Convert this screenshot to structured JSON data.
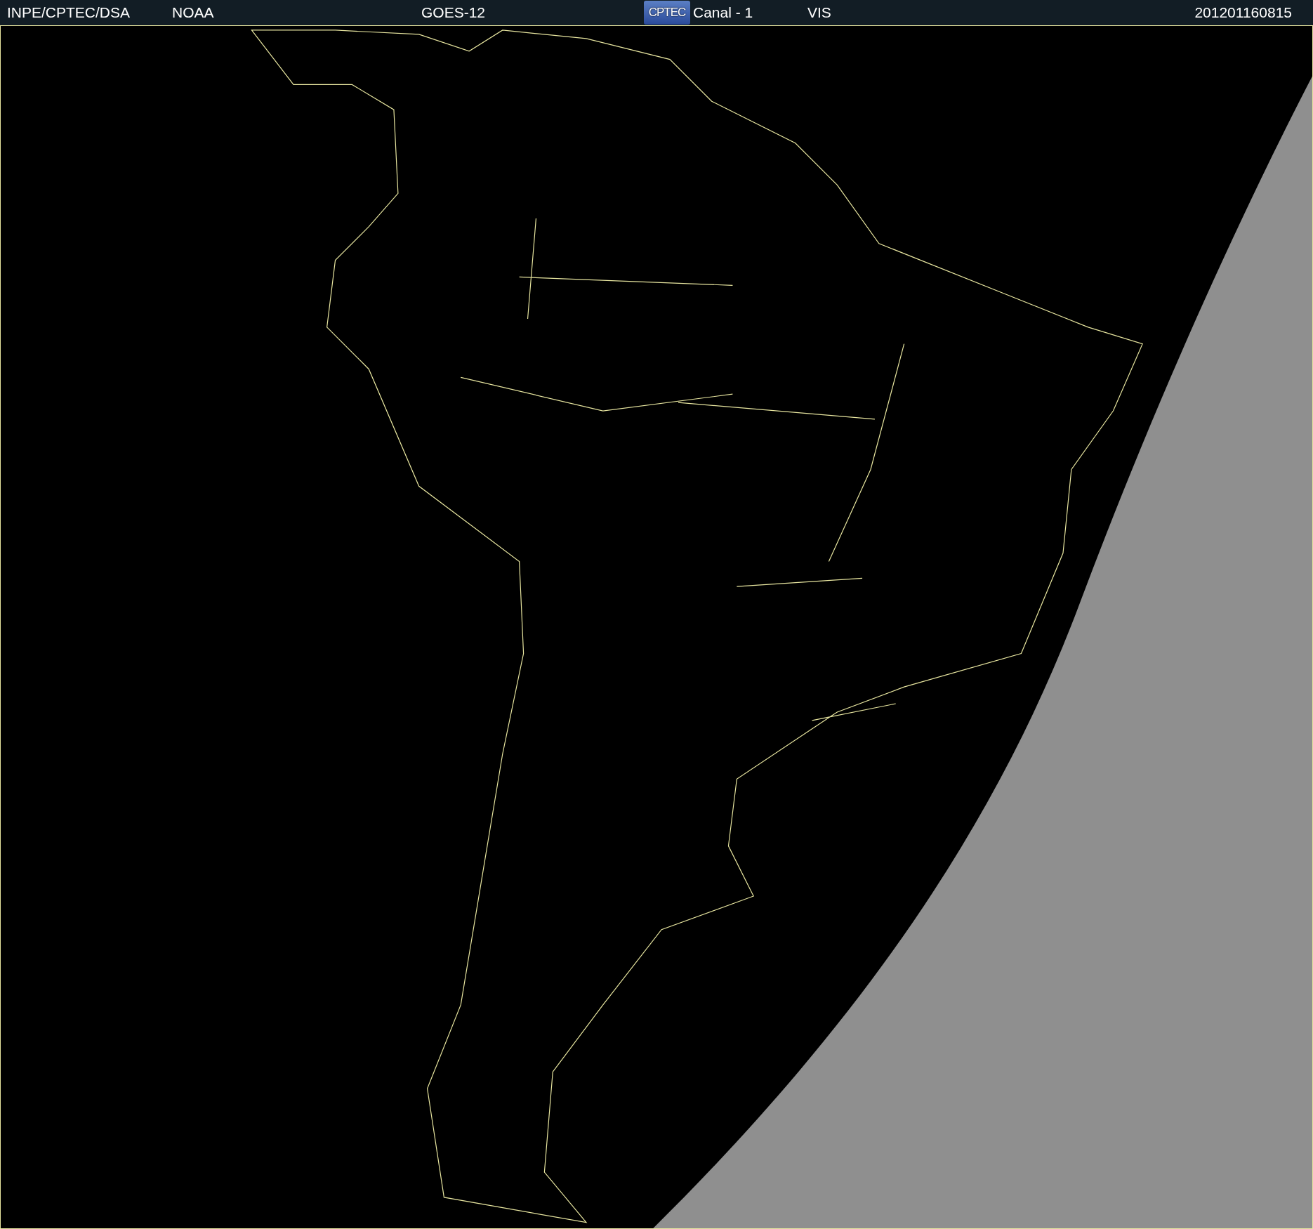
{
  "header": {
    "source": "INPE/CPTEC/DSA",
    "agency": "NOAA",
    "satellite": "GOES-12",
    "logo": "CPTEC",
    "channel": "Canal - 1",
    "band": "VIS",
    "timestamp": "201201160815"
  }
}
